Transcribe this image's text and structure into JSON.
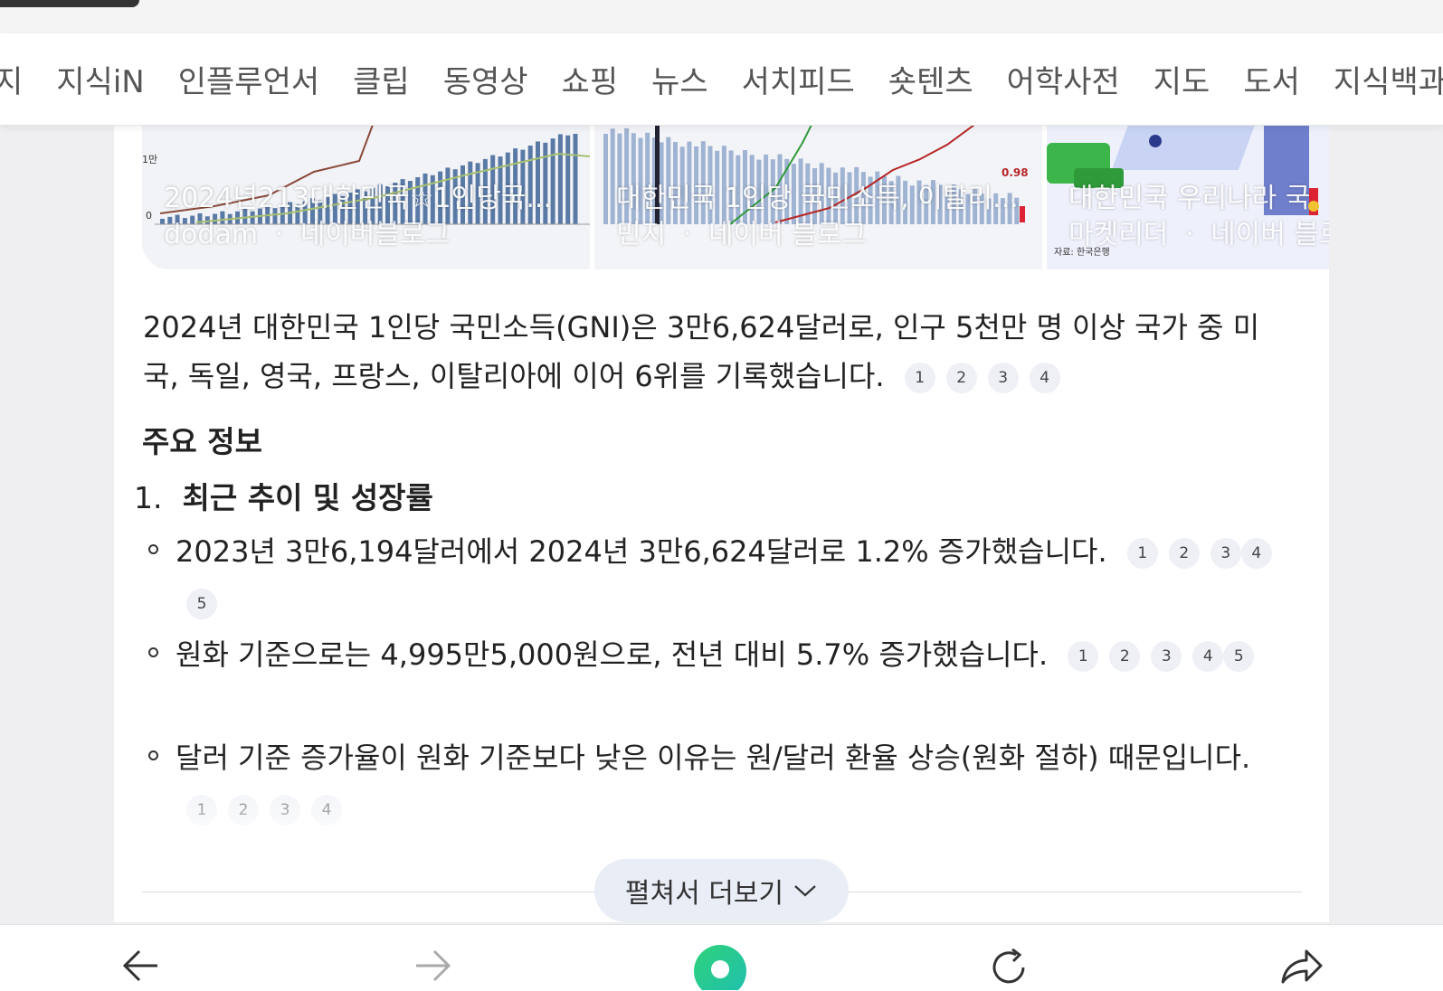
{
  "tabs": [
    "지",
    "지식iN",
    "인플루언서",
    "클립",
    "동영상",
    "쇼핑",
    "뉴스",
    "서치피드",
    "숏텐츠",
    "어학사전",
    "지도",
    "도서",
    "지식백과"
  ],
  "thumbnails": [
    {
      "title": "2024년213대한민국☆1인당국...",
      "source": "dodam ㆍ 네이버블로그"
    },
    {
      "title": "대한민국 1인당 국민소득, 이탈리...",
      "source": "민지 ㆍ 네이버 블로그"
    },
    {
      "title": "대한민국 우리나라 국",
      "source": "마켓리더 ㆍ 네이버 블로그"
    }
  ],
  "summary": {
    "text": "2024년 대한민국 1인당 국민소득(GNI)은 3만6,624달러로, 인구 5천만 명 이상 국가 중 미국, 독일, 영국, 프랑스, 이탈리아에 이어 6위를 기록했습니다.",
    "citations": [
      "1",
      "2",
      "3",
      "4"
    ]
  },
  "section_title": "주요 정보",
  "subsection": {
    "number": "1.",
    "title": "최근 추이 및 성장률"
  },
  "bullets": [
    {
      "text": "2023년 3만6,194달러에서 2024년 3만6,624달러로 1.2% 증가했습니다.",
      "citations": [
        "1",
        "2",
        "3",
        "4",
        "5"
      ]
    },
    {
      "text": "원화 기준으로는 4,995만5,000원으로, 전년 대비 5.7% 증가했습니다.",
      "citations": [
        "1",
        "2",
        "3",
        "4",
        "5"
      ]
    },
    {
      "text": "달러 기준 증가율이 원화 기준보다 낮은 이유는 원/달러 환율 상승(원화 절하) 때문입니다.",
      "citations": [
        "1",
        "2",
        "3",
        "4"
      ]
    }
  ],
  "expand_button": "펼쳐서 더보기",
  "chart_marks": {
    "thumb1_label_tick": "1만",
    "thumb1_label_zero": "0",
    "thumb2_value": "0.98",
    "thumb3_source": "자료: 한국은행"
  },
  "colors": {
    "accent_green": "#2fd27a",
    "citation_bg": "#eef0f5",
    "button_bg": "#e9edf6"
  },
  "icons": [
    "back-arrow-icon",
    "forward-arrow-icon",
    "home-icon",
    "reload-icon",
    "share-icon",
    "chevron-down-icon"
  ]
}
